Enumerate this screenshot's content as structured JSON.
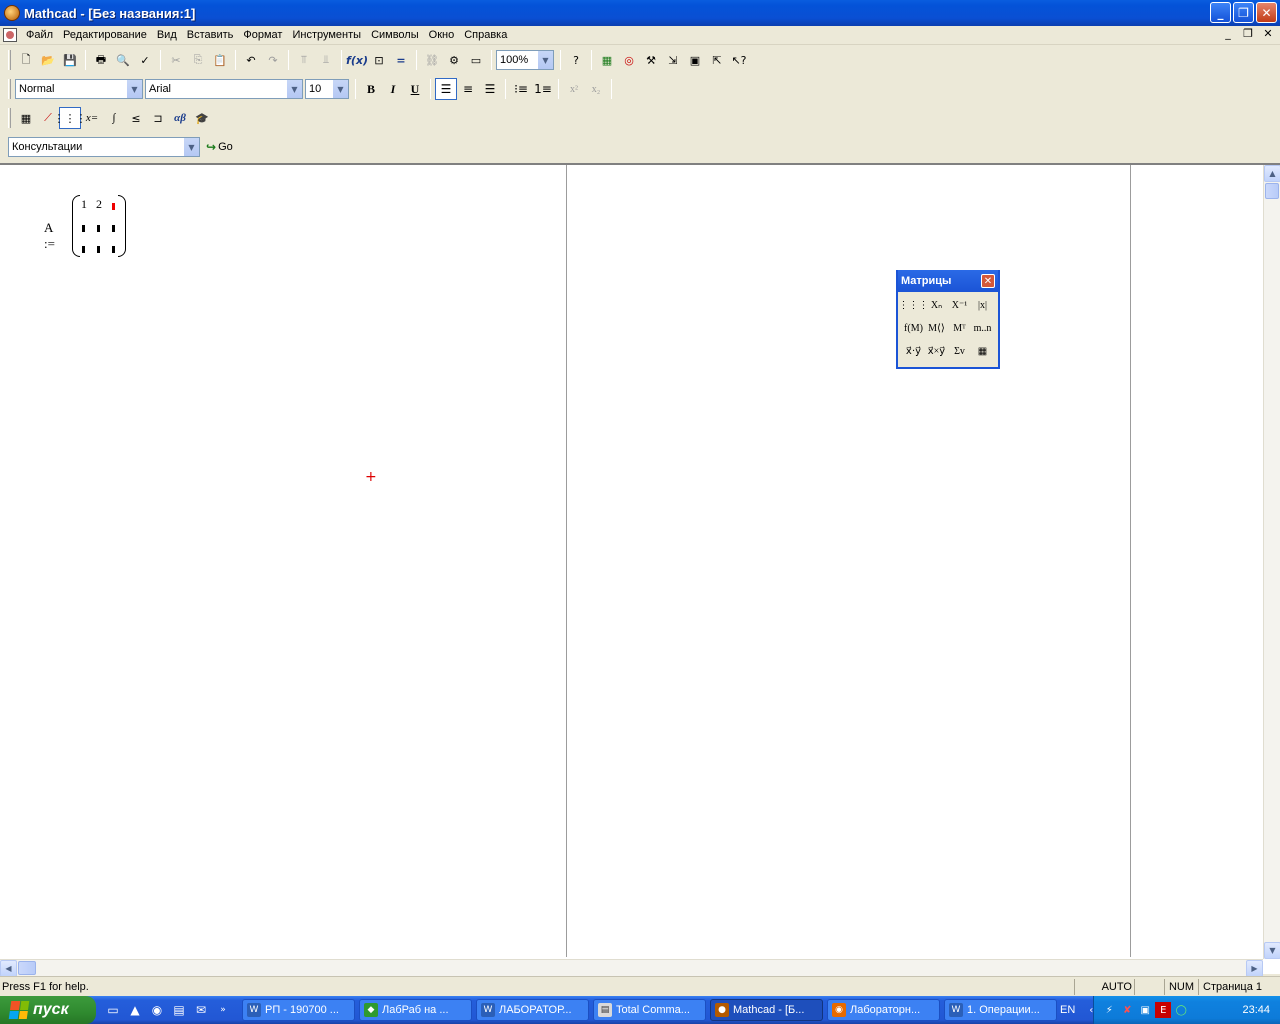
{
  "window": {
    "title": "Mathcad - [Без названия:1]",
    "minimize": "_",
    "maximize": "❐",
    "close": "✕"
  },
  "menu": [
    "Файл",
    "Редактирование",
    "Вид",
    "Вставить",
    "Формат",
    "Инструменты",
    "Символы",
    "Окно",
    "Справка"
  ],
  "mdi_controls": [
    "_",
    "❐",
    "✕"
  ],
  "toolbar_standard": {
    "zoom": "100%"
  },
  "toolbar_format": {
    "style": "Normal",
    "font": "Arial",
    "size": "10",
    "bold": "B",
    "italic": "I",
    "underline": "U",
    "superscript": "x²",
    "subscript": "x₂"
  },
  "toolbar_resources": {
    "value": "Консультации",
    "go": "Go"
  },
  "math_toolbar": {
    "eval": "x=",
    "greek": "αβ"
  },
  "document": {
    "lhs": "A :=",
    "row1": [
      "1",
      "2"
    ]
  },
  "palette": {
    "title": "Матрицы",
    "buttons": [
      "⋮⋮⋮",
      "Xₙ",
      "X⁻¹",
      "|x|",
      "f(M)",
      "M⟨⟩",
      "Mᵀ",
      "m..n",
      "x⃗·y⃗",
      "x⃗×y⃗",
      "Σv",
      "▦"
    ]
  },
  "status": {
    "help": "Press F1 for help.",
    "mode": "AUTO",
    "num": "NUM",
    "page": "Страница 1"
  },
  "taskbar": {
    "start": "пуск",
    "tasks": [
      {
        "label": "РП - 190700 ...",
        "icon_color": "#2b5fb8",
        "icon": "W"
      },
      {
        "label": "ЛабРаб на ...",
        "icon_color": "#2f9a2f",
        "icon": "◆"
      },
      {
        "label": "ЛАБОРАТОР...",
        "icon_color": "#2b5fb8",
        "icon": "W"
      },
      {
        "label": "Total Comma...",
        "icon_color": "#d9d9d9",
        "icon": "▤"
      },
      {
        "label": "Mathcad - [Б...",
        "icon_color": "#b45a00",
        "icon": "●"
      },
      {
        "label": "Лабораторн...",
        "icon_color": "#e66a00",
        "icon": "◉"
      },
      {
        "label": "1. Операции...",
        "icon_color": "#2b5fb8",
        "icon": "W"
      }
    ],
    "language": "EN",
    "clock": "23:44"
  }
}
